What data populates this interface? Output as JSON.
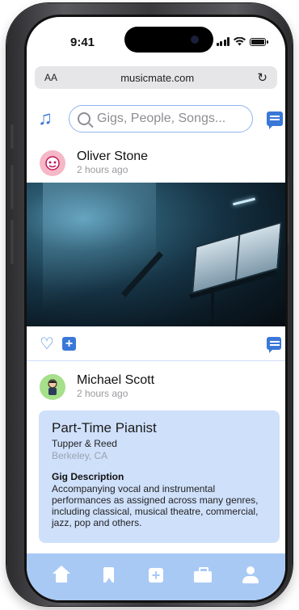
{
  "status_bar": {
    "time": "9:41"
  },
  "browser": {
    "text_size_label": "AA",
    "url": "musicmate.com",
    "reload_icon": "reload-icon"
  },
  "header": {
    "logo_icon": "music-note-icon",
    "search_placeholder": "Gigs, People, Songs...",
    "messages_icon": "chat-icon"
  },
  "posts": [
    {
      "author": "Oliver Stone",
      "time": "2 hours ago",
      "image": "dark stage with music stand and sheet music under blue spotlight",
      "actions": [
        "heart-icon",
        "add-icon",
        "comment-icon"
      ]
    },
    {
      "author": "Michael Scott",
      "time": "2 hours ago",
      "gig": {
        "title": "Part-Time Pianist",
        "company": "Tupper & Reed",
        "location": "Berkeley, CA",
        "description_heading": "Gig Description",
        "description": "Accompanying vocal and instrumental performances as assigned across many genres, including classical, musical theatre, commercial, jazz, pop and others."
      }
    }
  ],
  "bottom_nav": [
    "home-icon",
    "bookmark-icon",
    "add-icon",
    "briefcase-icon",
    "profile-icon"
  ],
  "colors": {
    "accent": "#3a78d8",
    "nav_bg": "#a9c9f5",
    "card_bg": "#cfe0fb"
  }
}
